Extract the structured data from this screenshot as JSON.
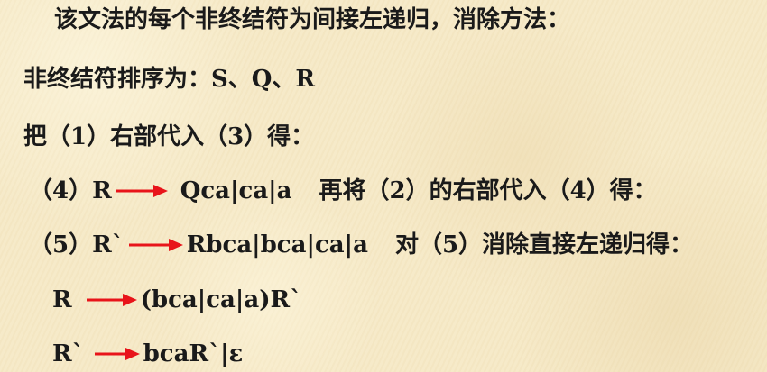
{
  "lines": {
    "l1": "该文法的每个非终结符为间接左递归，消除方法：",
    "l2": "非终结符排序为：S、Q、R",
    "l3": "把（1）右部代入（3）得：",
    "l4": {
      "lhs": "（4）R",
      "rhs": "Qca|ca|a",
      "note": "再将（2）的右部代入（4）得："
    },
    "l5": {
      "lhs": "（5）R`",
      "rhs": "Rbca|bca|ca|a",
      "note": "对（5）消除直接左递归得："
    },
    "l6": {
      "lhs": "R",
      "rhs": "(bca|ca|a)R`"
    },
    "l7": {
      "lhs": "R`",
      "rhs": "bcaR`|ε"
    }
  },
  "colors": {
    "text": "#1a1a1a",
    "arrow": "#e8141a",
    "background": "#f6e9c6"
  },
  "icons": {
    "arrow": "right-arrow-icon"
  }
}
